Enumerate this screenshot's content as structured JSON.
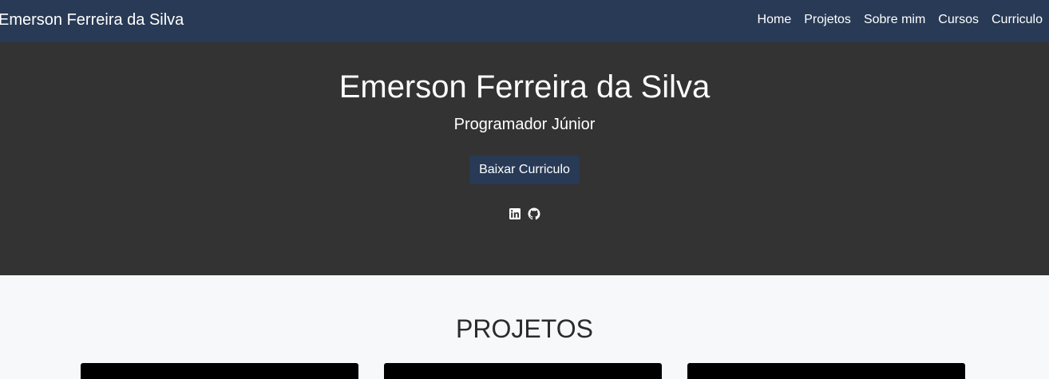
{
  "navbar": {
    "brand": "Emerson Ferreira da Silva",
    "links": [
      "Home",
      "Projetos",
      "Sobre mim",
      "Cursos",
      "Curriculo"
    ],
    "background": "#283a55"
  },
  "hero": {
    "title": "Emerson Ferreira da Silva",
    "subtitle": "Programador Júnior",
    "button_label": "Baixar Curriculo",
    "social_icons": [
      "linkedin-icon",
      "github-icon"
    ],
    "background": "#333333"
  },
  "projects": {
    "title": "PROJETOS",
    "card_count": 3,
    "card_color": "#000000"
  }
}
